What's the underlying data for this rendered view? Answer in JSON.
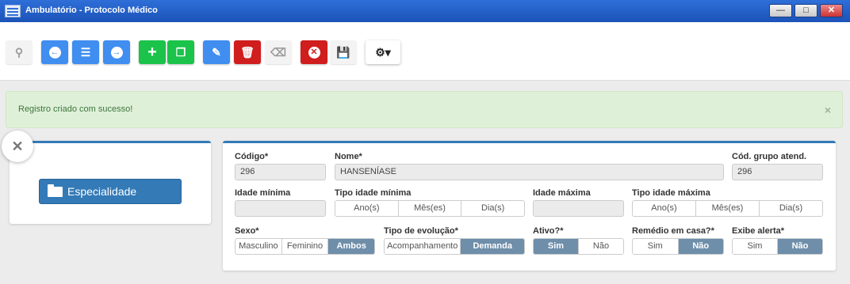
{
  "window": {
    "title": "Ambulatório - Protocolo Médico",
    "minimize_glyph": "—",
    "maximize_glyph": "□",
    "close_glyph": "✕"
  },
  "toolbar": {
    "search_glyph": "⚲",
    "prev_glyph": "←",
    "list_glyph": "☰",
    "next_glyph": "→",
    "add_glyph": "+",
    "copy_glyph": "❐",
    "edit_glyph": "✎",
    "delete_glyph": "🗑",
    "eraser_glyph": "⌫",
    "cancel_glyph": "✕",
    "save_glyph": "💾",
    "settings_glyph": "⚙▾"
  },
  "alert": {
    "message": "Registro criado com sucesso!",
    "close_glyph": "×"
  },
  "left_panel": {
    "close_glyph": "✕",
    "specialty_button": "Especialidade"
  },
  "form": {
    "codigo": {
      "label": "Código*",
      "value": "296"
    },
    "nome": {
      "label": "Nome*",
      "value": "HANSENÍASE"
    },
    "cod_grupo": {
      "label": "Cód. grupo atend.",
      "value": "296"
    },
    "idade_minima": {
      "label": "Idade mínima",
      "value": ""
    },
    "tipo_idade_minima": {
      "label": "Tipo idade mínima",
      "options": [
        "Ano(s)",
        "Mês(es)",
        "Dia(s)"
      ]
    },
    "idade_maxima": {
      "label": "Idade máxima",
      "value": ""
    },
    "tipo_idade_maxima": {
      "label": "Tipo idade máxima",
      "options": [
        "Ano(s)",
        "Mês(es)",
        "Dia(s)"
      ]
    },
    "sexo": {
      "label": "Sexo*",
      "options": [
        "Masculino",
        "Feminino",
        "Ambos"
      ],
      "selected": "Ambos"
    },
    "tipo_evolucao": {
      "label": "Tipo de evolução*",
      "options": [
        "Acompanhamento",
        "Demanda"
      ],
      "selected": "Demanda"
    },
    "ativo": {
      "label": "Ativo?*",
      "options": [
        "Sim",
        "Não"
      ],
      "selected": "Sim"
    },
    "remedio_casa": {
      "label": "Remédio em casa?*",
      "options": [
        "Sim",
        "Não"
      ],
      "selected": "Não"
    },
    "exibe_alerta": {
      "label": "Exibe alerta*",
      "options": [
        "Sim",
        "Não"
      ],
      "selected": "Não"
    }
  },
  "colors": {
    "titlebar": "#1b53b8",
    "primary": "#337ab7",
    "toolbar_blue": "#3f8ef0",
    "toolbar_green": "#1bc34a",
    "toolbar_red": "#d01d1d",
    "alert_bg": "#dff0d8",
    "toggle_on": "#6e8eaa"
  }
}
